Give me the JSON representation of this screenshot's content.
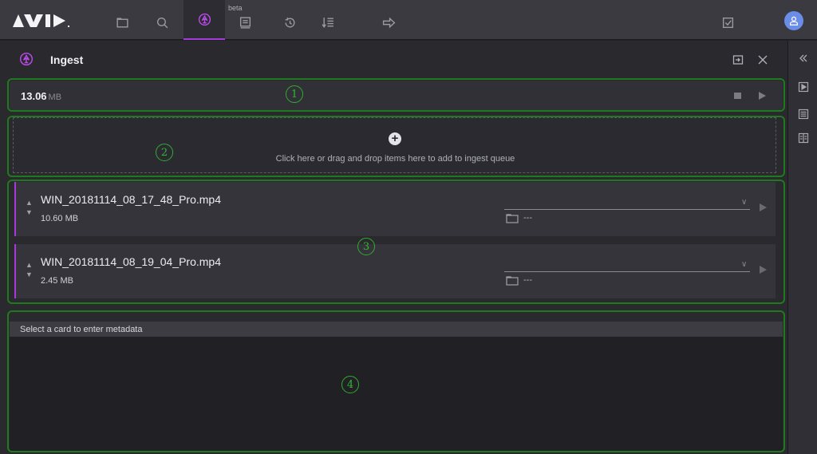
{
  "brand": {
    "logo": "AVID"
  },
  "nav": {
    "items": [
      {
        "icon": "folder-icon"
      },
      {
        "icon": "search-icon"
      },
      {
        "icon": "ingest-icon",
        "active": true
      },
      {
        "icon": "chat-icon",
        "badge": "beta"
      },
      {
        "icon": "history-icon"
      },
      {
        "icon": "rundown-icon"
      },
      {
        "icon": "export-arrow-icon"
      }
    ],
    "tasks_icon": "checkbox-icon",
    "user_icon": "user-avatar-icon",
    "accent_color": "#a63ad8"
  },
  "panel": {
    "title": "Ingest",
    "total_size_value": "13.06",
    "total_size_unit": "MB"
  },
  "drop_zone": {
    "text": "Click here or drag and drop items here to add to ingest queue"
  },
  "queue": [
    {
      "name": "WIN_20181114_08_17_48_Pro.mp4",
      "size": "10.60 MB",
      "destination": "---"
    },
    {
      "name": "WIN_20181114_08_19_04_Pro.mp4",
      "size": "2.45 MB",
      "destination": "---"
    }
  ],
  "metadata": {
    "placeholder": "Select a card to enter metadata"
  },
  "callouts": [
    "1",
    "2",
    "3",
    "4"
  ]
}
